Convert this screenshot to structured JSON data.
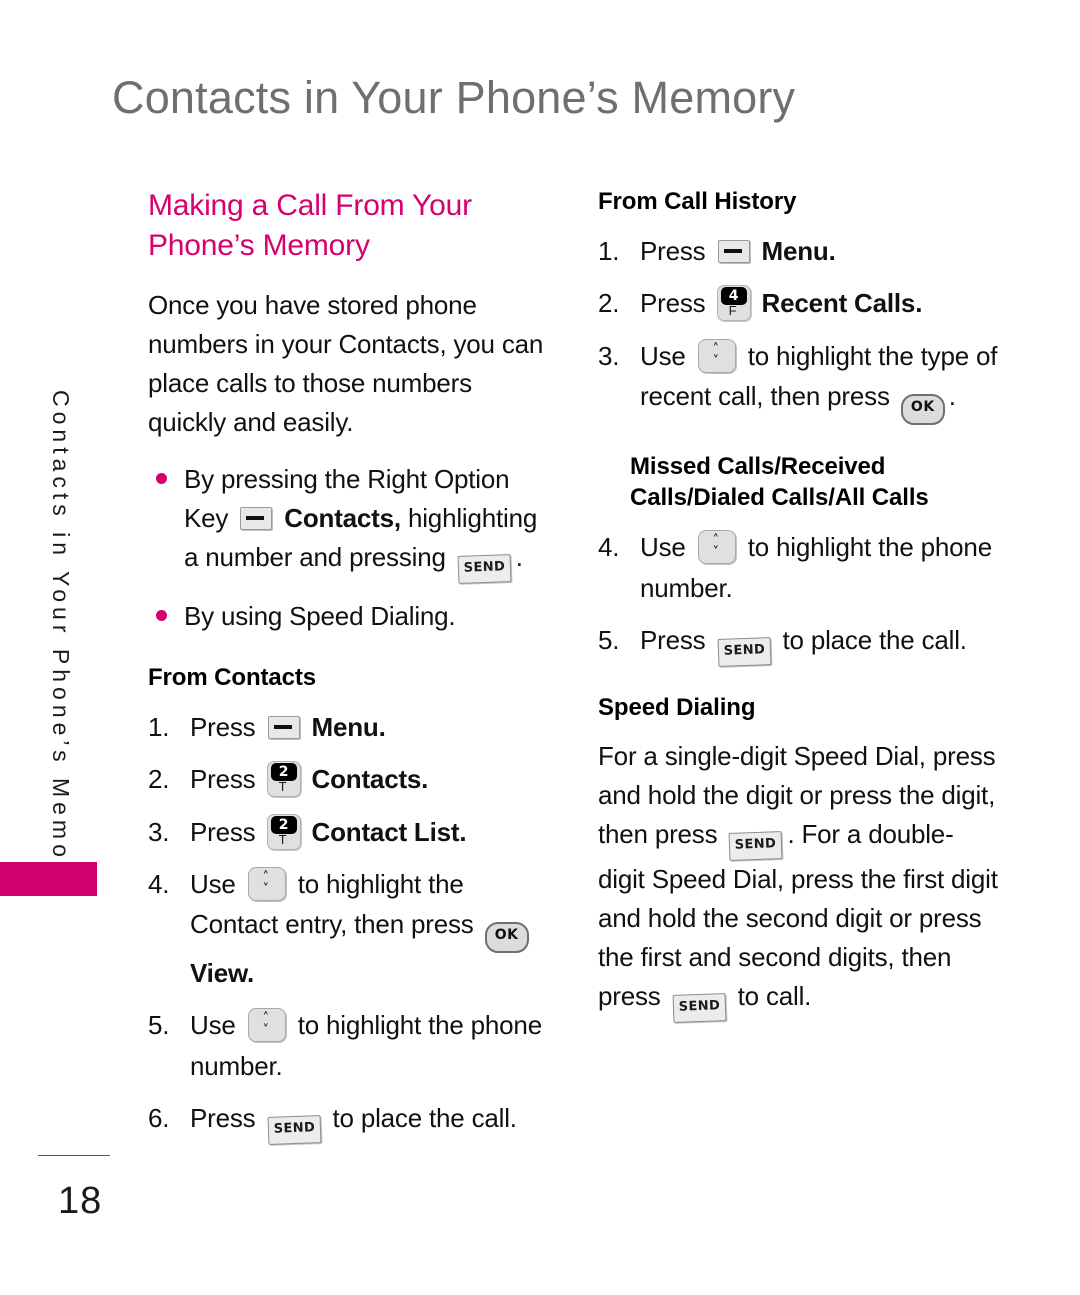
{
  "page": {
    "header_title": "Contacts in Your Phone’s Memory",
    "side_tab_label": "Contacts in Your Phone’s Memory",
    "page_number": "18",
    "accent_color": "#d6006e",
    "tab_color": "#d0006f",
    "header_color": "#706f6f"
  },
  "left_column": {
    "section_title": "Making a Call From Your Phone’s Memory",
    "intro_paragraph": "Once you have stored phone numbers in your Contacts, you can place calls to those numbers quickly and easily.",
    "bullets": [
      {
        "before": "By pressing the Right Option Key",
        "icon": "option-key-icon",
        "middle": "Contacts,",
        "after": "highlighting a number and pressing",
        "icon2": "send-key-icon",
        "tail": "."
      },
      {
        "text": "By using Speed Dialing."
      }
    ],
    "from_contacts": {
      "heading": "From Contacts",
      "steps": [
        {
          "num": "1.",
          "verb": "Press",
          "icon": "option-key-icon",
          "bold_text": "Menu",
          "tail": "."
        },
        {
          "num": "2.",
          "verb": "Press",
          "icon": "digit-key-2-icon",
          "digit": "2",
          "letter": "T",
          "bold_text": "Contacts",
          "tail": "."
        },
        {
          "num": "3.",
          "verb": "Press",
          "icon": "digit-key-2-icon",
          "digit": "2",
          "letter": "T",
          "bold_text": "Contact List",
          "tail": "."
        },
        {
          "num": "4.",
          "verb": "Use",
          "icon": "nav-updown-key-icon",
          "text": "to highlight the Contact entry, then press",
          "icon2": "ok-key-icon",
          "bold_text": "View",
          "tail": "."
        },
        {
          "num": "5.",
          "verb": "Use",
          "icon": "nav-updown-key-icon",
          "text": "to highlight the phone number."
        },
        {
          "num": "6.",
          "verb": "Press",
          "icon": "send-key-icon",
          "text": "to place the call."
        }
      ]
    }
  },
  "right_column": {
    "from_call_history": {
      "heading": "From Call History",
      "steps": [
        {
          "num": "1.",
          "verb": "Press",
          "icon": "option-key-icon",
          "bold_text": "Menu",
          "tail": "."
        },
        {
          "num": "2.",
          "verb": "Press",
          "icon": "digit-key-4-icon",
          "digit": "4",
          "letter": "F",
          "bold_text": "Recent Calls",
          "tail": "."
        },
        {
          "num": "3.",
          "verb": "Use",
          "icon": "nav-updown-key-icon",
          "text": "to highlight the type of recent call, then press",
          "icon2": "ok-key-icon",
          "tail": "."
        }
      ]
    },
    "missed_calls": {
      "heading": "Missed Calls/Received Calls/Dialed Calls/All Calls",
      "steps": [
        {
          "num": "4.",
          "verb": "Use",
          "icon": "nav-updown-key-icon",
          "text": "to highlight the phone number."
        },
        {
          "num": "5.",
          "verb": "Press",
          "icon": "send-key-icon",
          "text": "to place the call."
        }
      ]
    },
    "speed_dialing": {
      "heading": "Speed Dialing",
      "paragraph_part1": "For a single-digit Speed Dial, press and hold the digit or press the digit, then press",
      "paragraph_part2": ". For a double-digit Speed Dial, press the first digit and hold the second digit or press the first and second digits, then press",
      "paragraph_part3": "to call."
    }
  },
  "icons": {
    "option_key": "option-key-icon",
    "send_key_label": "SEND",
    "ok_key_label": "OK",
    "nav_up": "˄",
    "nav_down": "˅"
  }
}
